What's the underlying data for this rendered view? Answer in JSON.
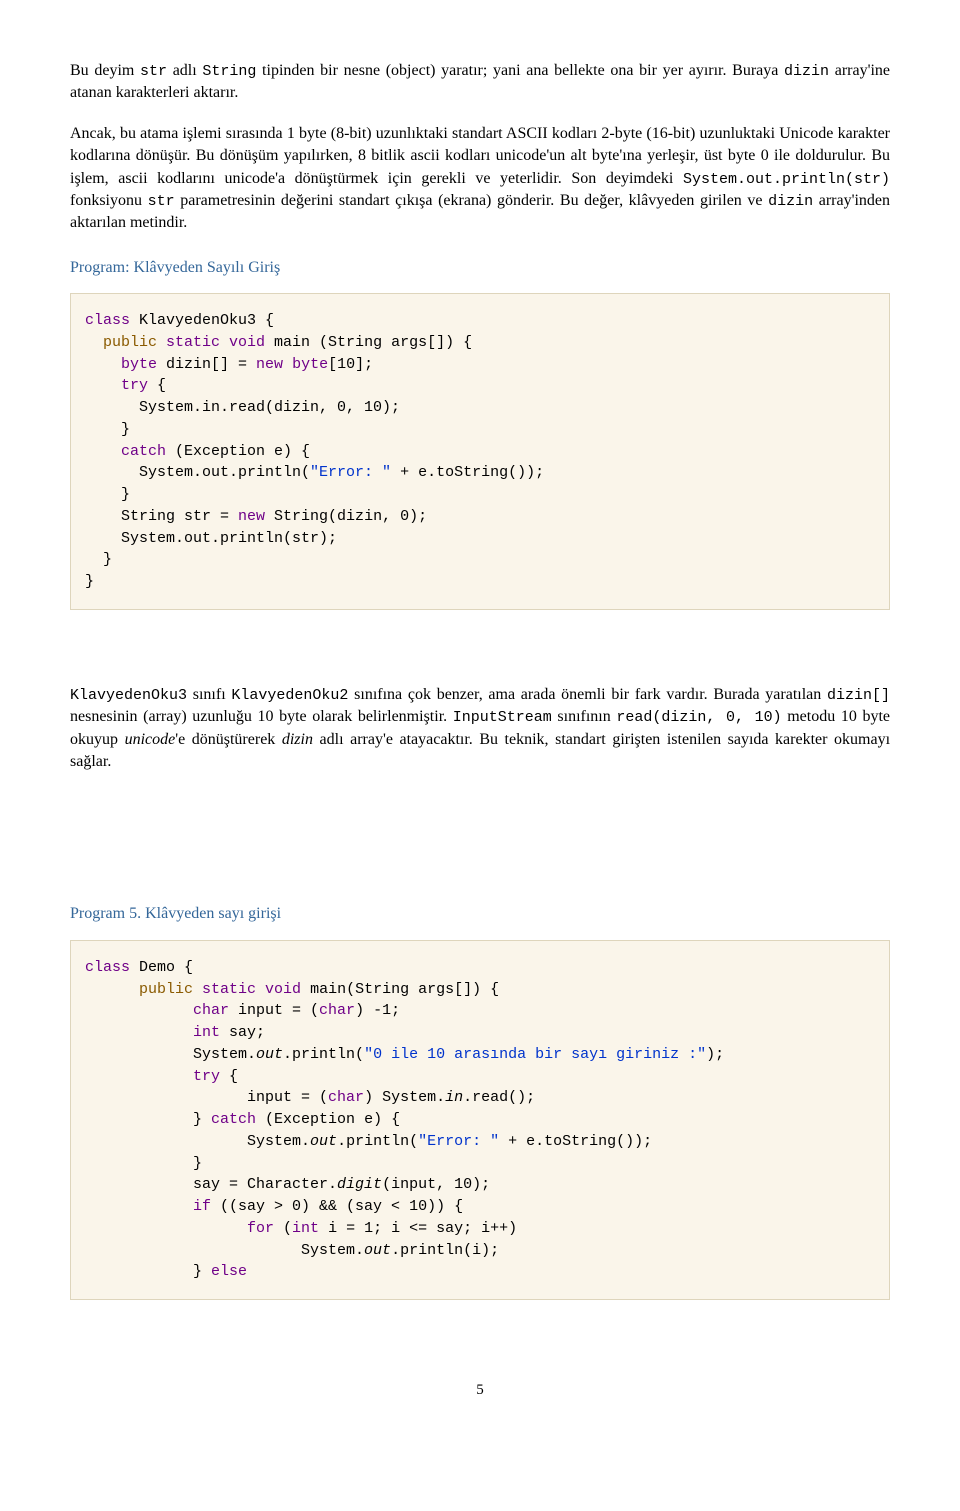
{
  "para1": {
    "t1": "Bu deyim ",
    "t2": "str",
    "t3": " adlı ",
    "t4": "String",
    "t5": " tipinden bir nesne (object) yaratır; yani ana bellekte ona bir yer ayırır. Buraya ",
    "t6": "dizin",
    "t7": " array'ine atanan karakterleri aktarır."
  },
  "para2": {
    "t1": "Ancak, bu atama işlemi sırasında 1 byte (8-bit) uzunlıktaki standart ASCII kodları 2-byte (16-bit) uzunluktaki Unicode karakter kodlarına dönüşür. Bu dönüşüm yapılırken, 8 bitlik ascii kodları unicode'un alt byte'ına yerleşir, üst byte 0 ile doldurulur. Bu işlem, ascii kodlarını unicode'a dönüştürmek için gerekli ve yeterlidir. Son deyimdeki ",
    "t2": "System.out.println(str)",
    "t3": "  fonksiyonu ",
    "t4": "str",
    "t5": " parametresinin değerini standart çıkışa (ekrana) gönderir. Bu değer, klâvyeden girilen ve ",
    "t6": "dizin",
    "t7": " array'inden aktarılan metindir."
  },
  "heading1": "Program: Klâvyeden Sayılı Giriş",
  "code1": {
    "l1a": "class",
    "l1b": " KlavyedenOku3 {",
    "l2a": "  public",
    "l2b": " static",
    "l2c": " void",
    "l2d": " main (String args[]) {",
    "l3a": "    byte",
    "l3b": " dizin[] = ",
    "l3c": "new",
    "l3d": " byte",
    "l3e": "[10];",
    "l4a": "    try",
    "l4b": " {",
    "l5": "      System.in.read(dizin, 0, 10);",
    "l6": "    }",
    "l7a": "    catch",
    "l7b": " (Exception e) {",
    "l8a": "      System.out.println(",
    "l8b": "\"Error: \"",
    "l8c": " + e.toString());",
    "l9": "    }",
    "l10a": "    String str = ",
    "l10b": "new",
    "l10c": " String(dizin, 0);",
    "l11": "    System.out.println(str);",
    "l12": "  }",
    "l13": "}"
  },
  "para3": {
    "t1": "KlavyedenOku3",
    "t2": " sınıfı ",
    "t3": "KlavyedenOku2",
    "t4": "  sınıfına çok benzer, ama arada önemli bir fark vardır. Burada yaratılan ",
    "t5": "dizin[]",
    "t6": " nesnesinin (array) uzunluğu 10 byte olarak belirlenmiştir. ",
    "t7": "InputStream",
    "t8": " sınıfının  ",
    "t9": "read(dizin, 0, 10)",
    "t10": " metodu  10 byte okuyup ",
    "t11": "unicode",
    "t12": "'e dönüştürerek ",
    "t13": "dizin",
    "t14": " adlı array'e atayacaktır. Bu teknik, standart girişten istenilen sayıda karekter okumayı sağlar."
  },
  "heading2": "Program 5. Klâvyeden sayı girişi",
  "code2": {
    "l1a": "class",
    "l1b": " Demo {",
    "l2a": "      public",
    "l2b": " static",
    "l2c": " void",
    "l2d": " main(String args[]) {",
    "l3a": "            char",
    "l3b": " input = (",
    "l3c": "char",
    "l3d": ") -1;",
    "l4a": "            int",
    "l4b": " say;",
    "l5a": "            System.",
    "l5b": "out",
    "l5c": ".println(",
    "l5d": "\"0 ile 10 arasında bir sayı giriniz :\"",
    "l5e": ");",
    "l6a": "            try",
    "l6b": " {",
    "l7a": "                  input = (",
    "l7b": "char",
    "l7c": ") System.",
    "l7d": "in",
    "l7e": ".read();",
    "l8a": "            } ",
    "l8b": "catch",
    "l8c": " (Exception e) {",
    "l9a": "                  System.",
    "l9b": "out",
    "l9c": ".println(",
    "l9d": "\"Error: \"",
    "l9e": " + e.toString());",
    "l10": "            }",
    "l11a": "            say = Character.",
    "l11b": "digit",
    "l11c": "(input, 10);",
    "l12a": "            if",
    "l12b": " ((say > 0) && (say < 10)) {",
    "l13a": "                  for",
    "l13b": " (",
    "l13c": "int",
    "l13d": " i = 1; i <= say; i++)",
    "l14a": "                        System.",
    "l14b": "out",
    "l14c": ".println(i);",
    "l15a": "            } ",
    "l15b": "else"
  },
  "page_number": "5"
}
